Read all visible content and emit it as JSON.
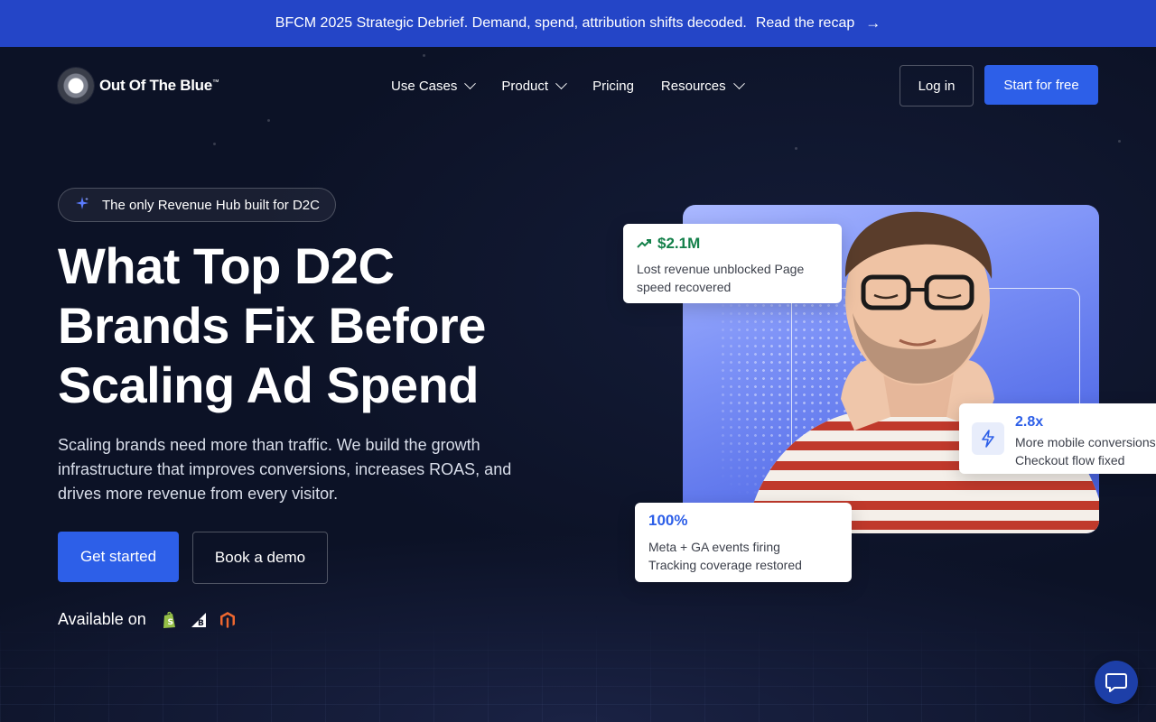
{
  "announcement": {
    "text": "BFCM 2025 Strategic Debrief. Demand, spend, attribution shifts decoded.",
    "link_label": "Read the recap"
  },
  "nav": {
    "brand": "Out Of The Blue",
    "brand_tm": "™",
    "items": [
      {
        "label": "Use Cases",
        "dropdown": true
      },
      {
        "label": "Product",
        "dropdown": true
      },
      {
        "label": "Pricing",
        "dropdown": false
      },
      {
        "label": "Resources",
        "dropdown": true
      }
    ],
    "login_label": "Log in",
    "start_label": "Start for free"
  },
  "hero": {
    "badge": "The only Revenue Hub built for D2C",
    "title_lines": [
      "What Top D2C",
      "Brands Fix Before",
      "Scaling Ad Spend"
    ],
    "subtitle": "Scaling brands need more than traffic. We build the growth infrastructure that improves conversions, increases ROAS, and drives more revenue from every visitor.",
    "cta_primary": "Get started",
    "cta_secondary": "Book a demo",
    "available_label": "Available on",
    "platforms": [
      "shopify-icon",
      "bigcommerce-icon",
      "magento-icon"
    ]
  },
  "stats": [
    {
      "value": "$2.1M",
      "desc": [
        "Lost revenue unblocked Page",
        "speed recovered"
      ],
      "icon": "trend-up-icon"
    },
    {
      "value": "2.8x",
      "desc": [
        "More mobile conversions",
        "Checkout flow fixed"
      ],
      "icon": "lightning-icon"
    },
    {
      "value": "100%",
      "desc": [
        "Meta + GA events firing",
        "Tracking coverage restored"
      ]
    }
  ],
  "colors": {
    "accent": "#2d5fe8",
    "announce_bg": "#2445c7",
    "page_bg": "#0c1226",
    "positive": "#14804a"
  }
}
